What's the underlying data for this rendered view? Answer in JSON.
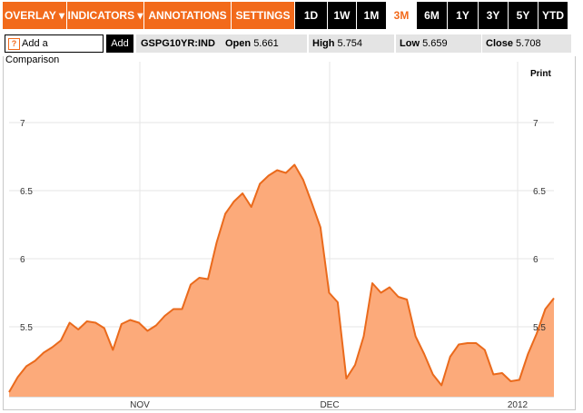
{
  "toolbar": {
    "menus": [
      {
        "label": "OVERLAY ▾"
      },
      {
        "label": "INDICATORS ▾"
      },
      {
        "label": "ANNOTATIONS ▾"
      },
      {
        "label": "SETTINGS ▾"
      }
    ],
    "ranges": [
      {
        "label": "1D"
      },
      {
        "label": "1W"
      },
      {
        "label": "1M"
      },
      {
        "label": "3M",
        "active": true
      },
      {
        "label": "6M"
      },
      {
        "label": "1Y"
      },
      {
        "label": "3Y"
      },
      {
        "label": "5Y"
      },
      {
        "label": "YTD"
      }
    ]
  },
  "quote": {
    "compare_label": "Add a Comparison",
    "compare_icon": "?",
    "add_label": "Add",
    "ticker": "GSPG10YR:IND",
    "open_label": "Open",
    "open_value": "5.661",
    "high_label": "High",
    "high_value": "5.754",
    "low_label": "Low",
    "low_value": "5.659",
    "close_label": "Close",
    "close_value": "5.708"
  },
  "print_label": "Print",
  "colors": {
    "accent": "#f26a1b",
    "area_fill": "#fcaa7a",
    "line": "#ea6a1c"
  },
  "chart_data": {
    "type": "area",
    "y_ticks": [
      5.5,
      6,
      6.5,
      7
    ],
    "y_tick_labels": [
      "5.5",
      "6",
      "6.5",
      "7"
    ],
    "x_tick_labels": [
      "NOV",
      "DEC",
      "2012"
    ],
    "ylim": [
      5,
      7.25
    ],
    "grid": true,
    "values": [
      5.02,
      5.13,
      5.21,
      5.25,
      5.31,
      5.35,
      5.4,
      5.53,
      5.48,
      5.54,
      5.53,
      5.49,
      5.33,
      5.52,
      5.55,
      5.53,
      5.47,
      5.51,
      5.58,
      5.63,
      5.63,
      5.81,
      5.86,
      5.85,
      6.12,
      6.33,
      6.42,
      6.48,
      6.38,
      6.55,
      6.61,
      6.65,
      6.63,
      6.69,
      6.58,
      6.41,
      6.23,
      5.75,
      5.68,
      5.12,
      5.22,
      5.43,
      5.82,
      5.75,
      5.79,
      5.72,
      5.7,
      5.43,
      5.3,
      5.15,
      5.07,
      5.28,
      5.37,
      5.38,
      5.38,
      5.33,
      5.15,
      5.16,
      5.1,
      5.11,
      5.3,
      5.45,
      5.63,
      5.71
    ]
  }
}
